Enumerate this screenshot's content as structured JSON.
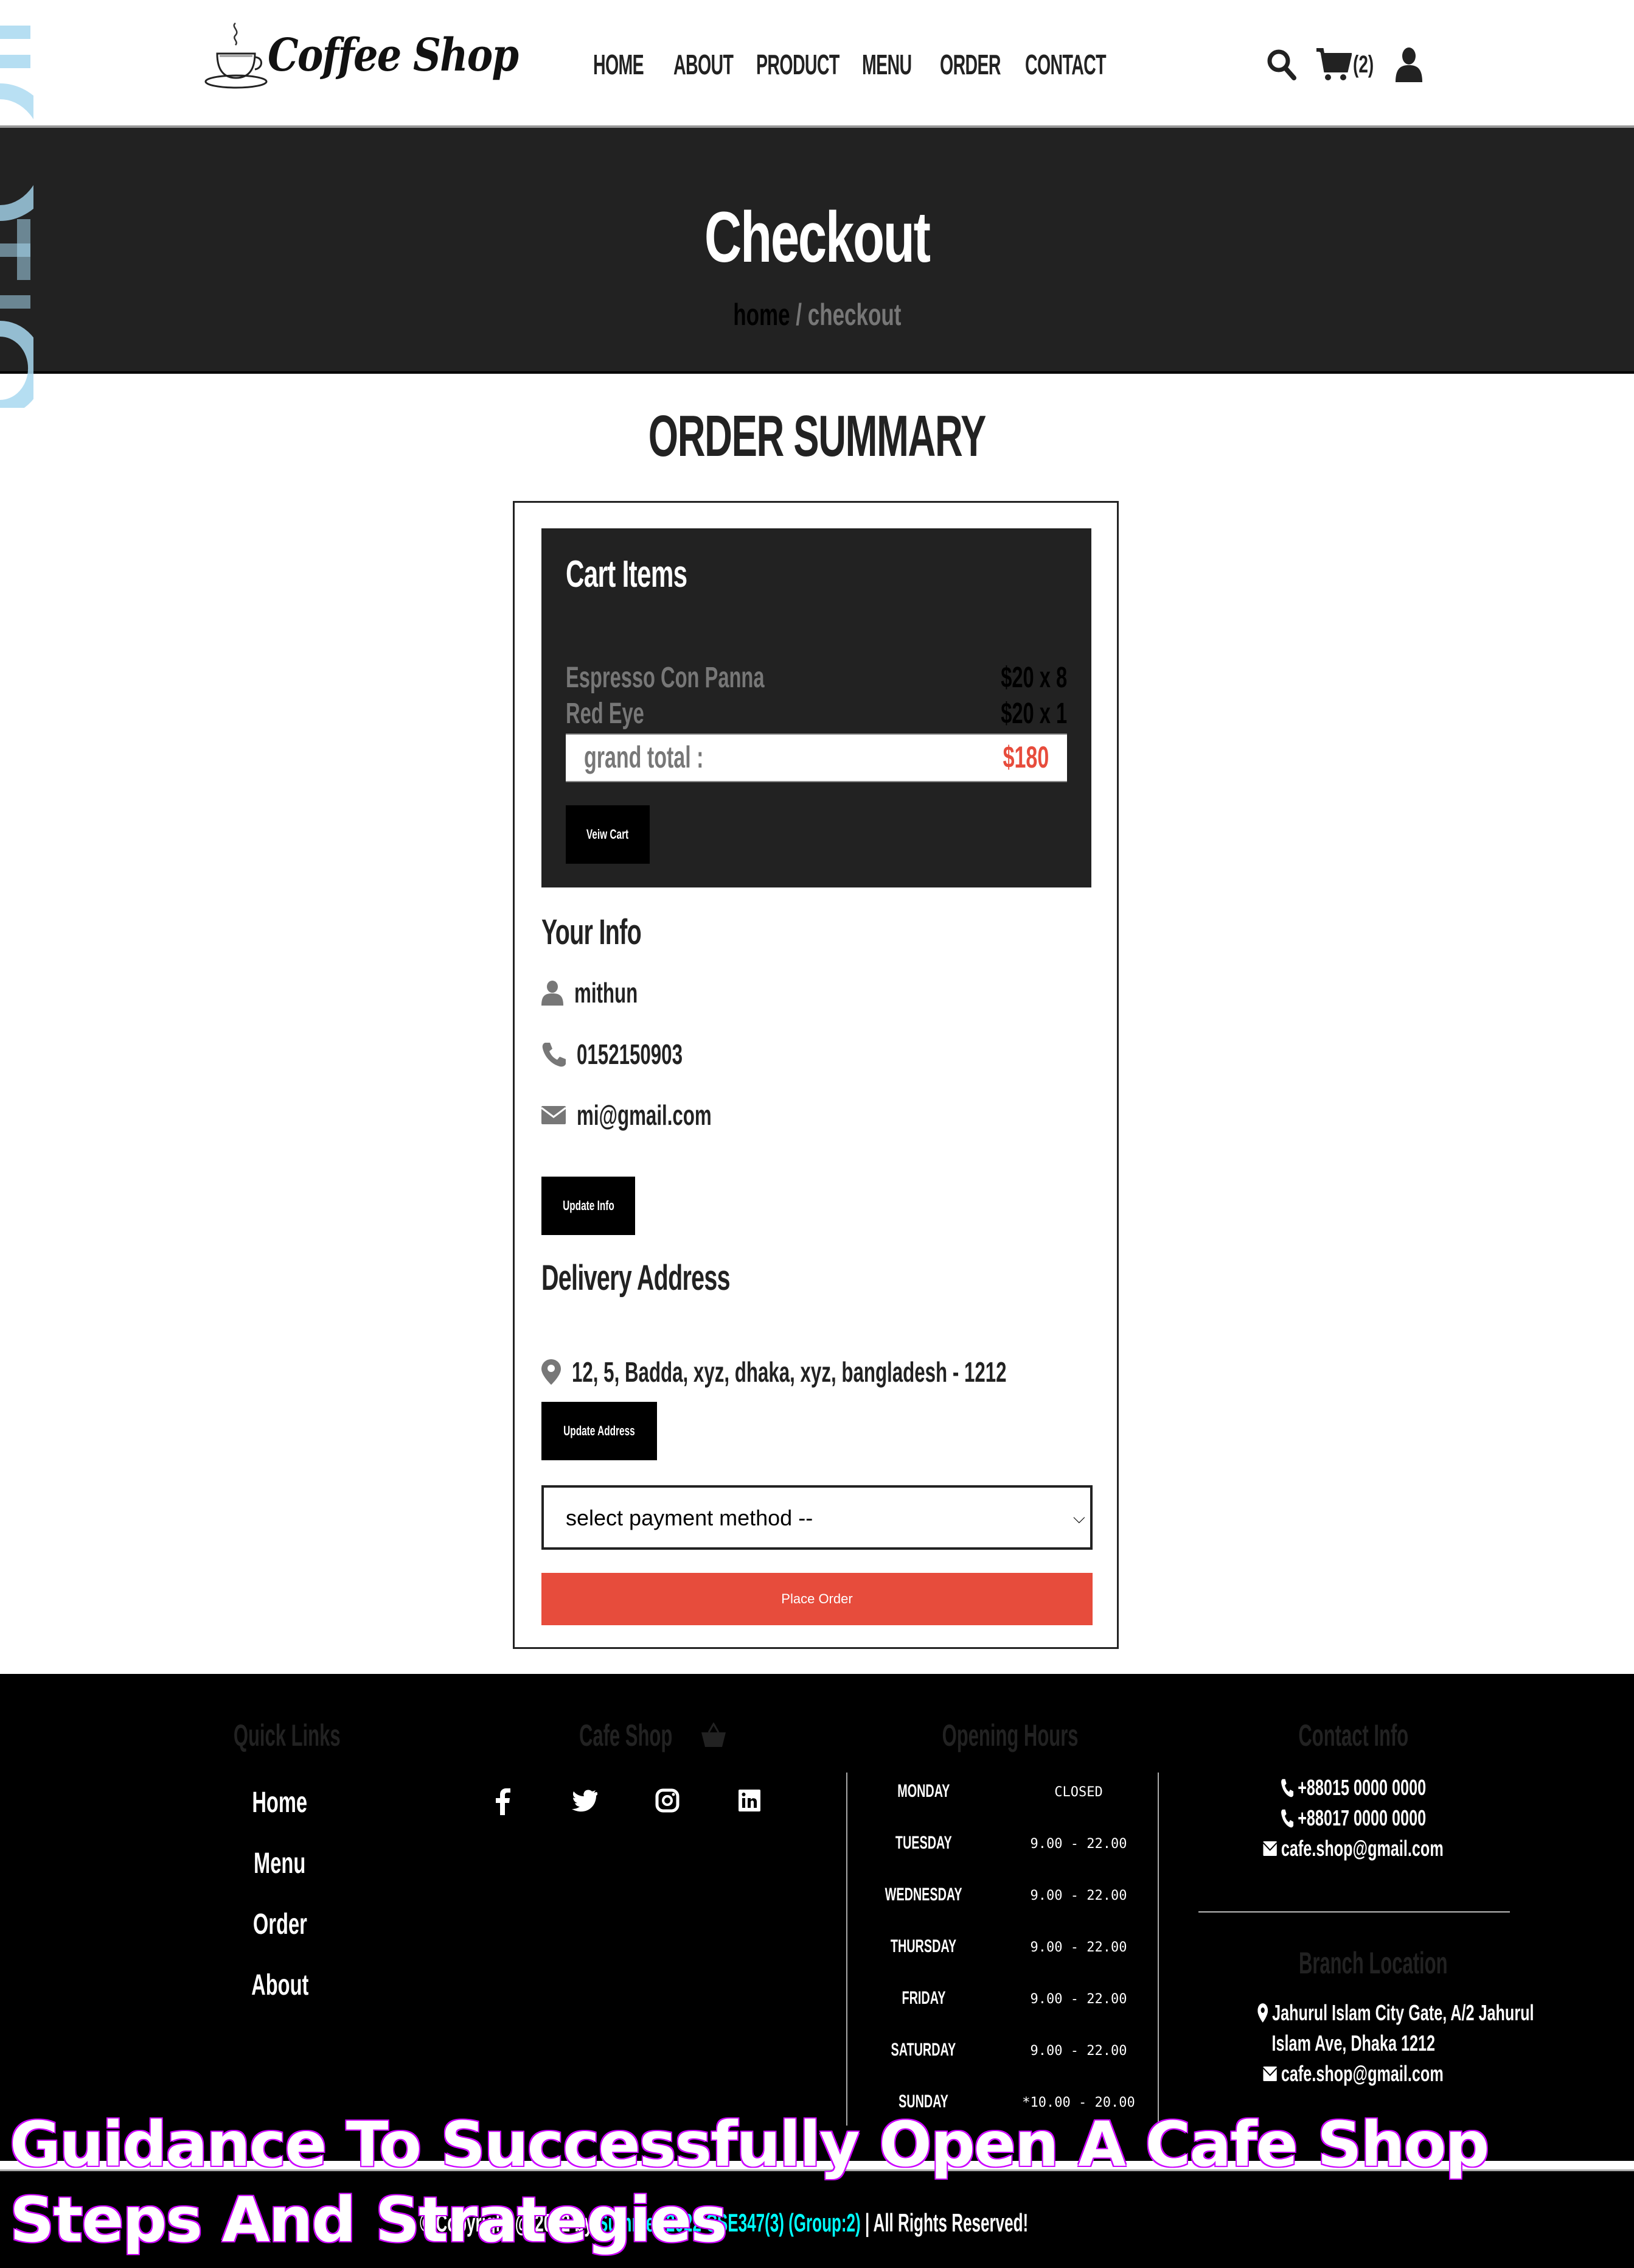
{
  "header": {
    "logo_text": "Coffee Shop",
    "nav": [
      "HOME",
      "ABOUT",
      "PRODUCT",
      "MENU",
      "ORDER",
      "CONTACT"
    ],
    "cart_count": "(2)",
    "icons": [
      "search-icon",
      "shopping-cart-icon",
      "user-icon"
    ]
  },
  "hero": {
    "title": "Checkout",
    "breadcrumb": {
      "home": "home",
      "separator": "/",
      "current": "checkout"
    }
  },
  "order_summary": {
    "title": "ORDER SUMMARY",
    "cart": {
      "heading": "Cart Items",
      "items": [
        {
          "name": "Espresso Con Panna",
          "price": "$20 x 8"
        },
        {
          "name": "Red Eye",
          "price": "$20 x 1"
        }
      ],
      "grand_total_label": "grand total :",
      "grand_total_value": "$180",
      "view_cart_label": "Veiw Cart"
    },
    "your_info": {
      "heading": "Your Info",
      "name": "mithun",
      "phone": "0152150903",
      "email": "mi@gmail.com",
      "update_label": "Update Info"
    },
    "delivery": {
      "heading": "Delivery Address",
      "address": "12, 5, Badda, xyz, dhaka, xyz, bangladesh - 1212",
      "update_label": "Update Address"
    },
    "payment": {
      "selected": "select payment method --"
    },
    "place_order_label": "Place Order",
    "accent_color": "#e74c3c"
  },
  "footer": {
    "quick_links": {
      "heading": "Quick Links",
      "links": [
        "Home",
        "Menu",
        "Order",
        "About"
      ]
    },
    "cafe_shop": {
      "heading": "Cafe Shop",
      "social": [
        "facebook-icon",
        "twitter-icon",
        "instagram-icon",
        "linkedin-icon"
      ]
    },
    "opening_hours": {
      "heading": "Opening Hours",
      "rows": [
        {
          "day": "MONDAY",
          "time": "CLOSED"
        },
        {
          "day": "TUESDAY",
          "time": "9.00 - 22.00"
        },
        {
          "day": "WEDNESDAY",
          "time": "9.00 - 22.00"
        },
        {
          "day": "THURSDAY",
          "time": "9.00 - 22.00"
        },
        {
          "day": "FRIDAY",
          "time": "9.00 - 22.00"
        },
        {
          "day": "SATURDAY",
          "time": "9.00 - 22.00"
        },
        {
          "day": "SUNDAY",
          "time": "*10.00 - 20.00"
        }
      ]
    },
    "contact_info": {
      "heading": "Contact Info",
      "phone1": "+88015 0000 0000",
      "phone2": "+88017 0000 0000",
      "email": "cafe.shop@gmail.com"
    },
    "branch": {
      "heading": "Branch Location",
      "address_line1": "Jahurul Islam City Gate, A/2 Jahurul",
      "address_line2": "Islam Ave, Dhaka 1212",
      "email": "cafe.shop@gmail.com"
    },
    "copyright": {
      "prefix": "© Copyright @ 2022 by ",
      "accent": "Summer-2022 CSE347(3) (Group:2)",
      "suffix": " | All Rights Reserved!"
    }
  },
  "overlay": {
    "line1": "Guidance To Successfully Open A Cafe Shop",
    "line2": "Steps And Strategies"
  }
}
